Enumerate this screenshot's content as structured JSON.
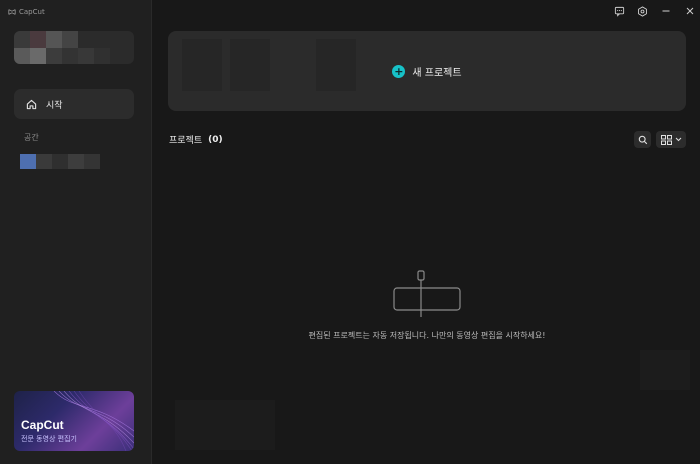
{
  "app": {
    "name": "CapCut"
  },
  "sidebar": {
    "nav": [
      {
        "label": "시작",
        "icon": "home-icon"
      }
    ],
    "section_title": "공간",
    "promo": {
      "title": "CapCut",
      "subtitle": "전문 동영상 편집기"
    }
  },
  "window_controls": {
    "icons": [
      "feedback-icon",
      "settings-icon",
      "minimize-icon",
      "close-icon"
    ]
  },
  "main": {
    "new_project_label": "새 프로젝트",
    "projects_title": "프로젝트",
    "projects_count": "(0)",
    "empty_message": "편집된 프로젝트는 자동 저장됩니다. 나만의 동영상 편집을 시작하세요!"
  },
  "colors": {
    "accent": "#17c2c8",
    "background": "#181818",
    "sidebar": "#202020",
    "card": "#2b2b2b"
  }
}
